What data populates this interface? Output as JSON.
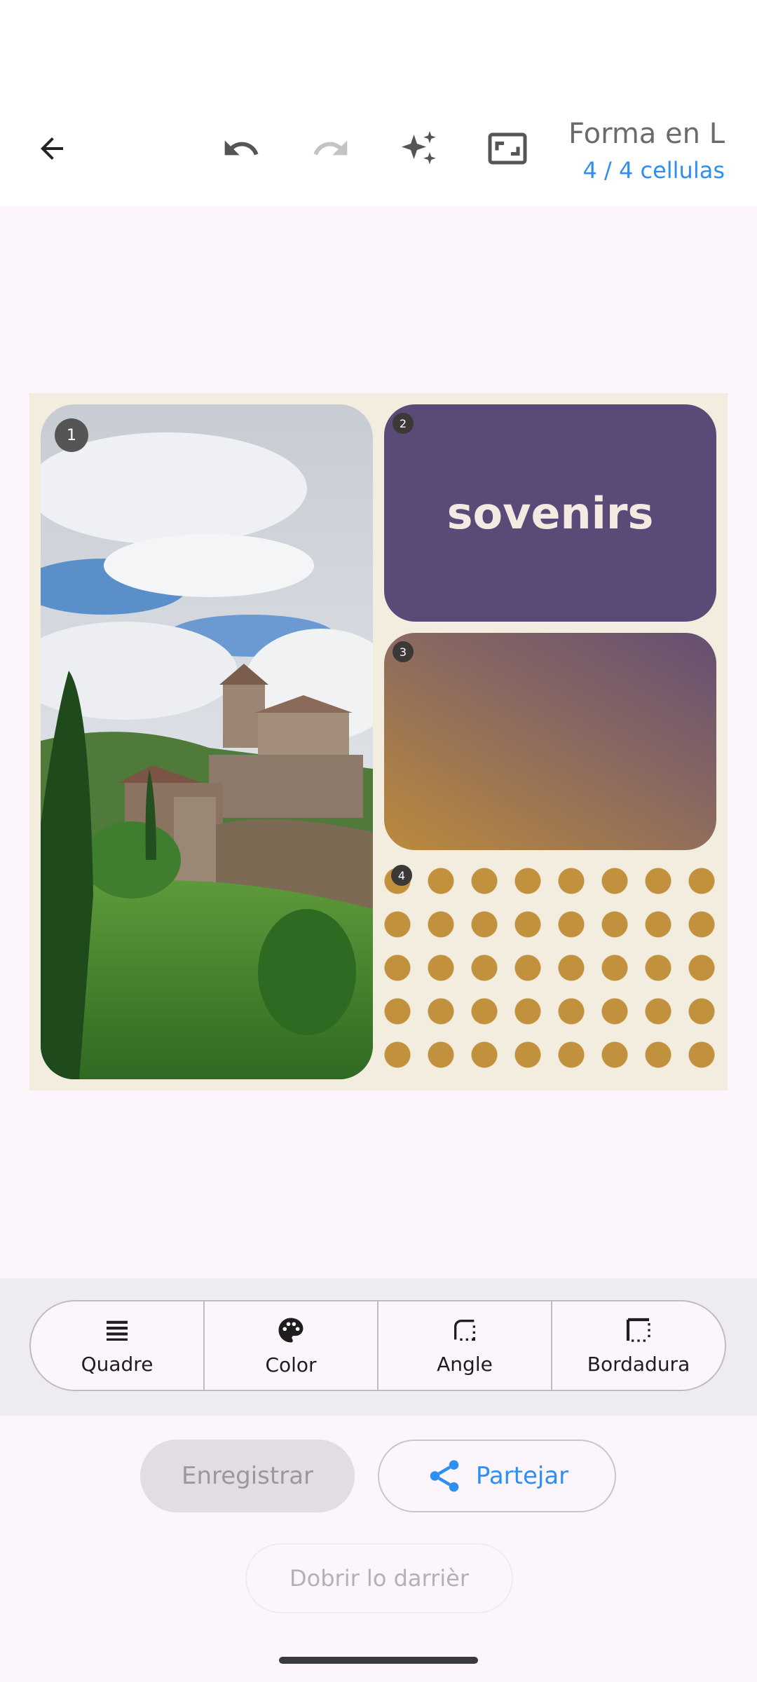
{
  "header": {
    "title": "Forma en L",
    "subtitle": "4 / 4 cellulas",
    "icons": [
      "back-arrow-icon",
      "undo-icon",
      "redo-icon",
      "sparkle-icon",
      "aspect-ratio-icon"
    ]
  },
  "collage": {
    "cells": [
      {
        "number": "1",
        "content": "photo-village-castle"
      },
      {
        "number": "2",
        "text": "sovenirs"
      },
      {
        "number": "3",
        "content": "gradient"
      },
      {
        "number": "4",
        "content": "dot-pattern"
      }
    ],
    "colors": {
      "background": "#f3eddf",
      "sticker": "#5a4a78",
      "dots": "#c2913d"
    }
  },
  "toolbar": {
    "items": [
      {
        "label": "Quadre",
        "icon": "lines-icon"
      },
      {
        "label": "Color",
        "icon": "palette-icon"
      },
      {
        "label": "Angle",
        "icon": "corner-icon"
      },
      {
        "label": "Bordadura",
        "icon": "border-icon"
      }
    ]
  },
  "actions": {
    "save_label": "Enregistrar",
    "share_label": "Partejar",
    "open_last_label": "Dobrir lo darrièr"
  },
  "accent_color": "#2d8ff0"
}
